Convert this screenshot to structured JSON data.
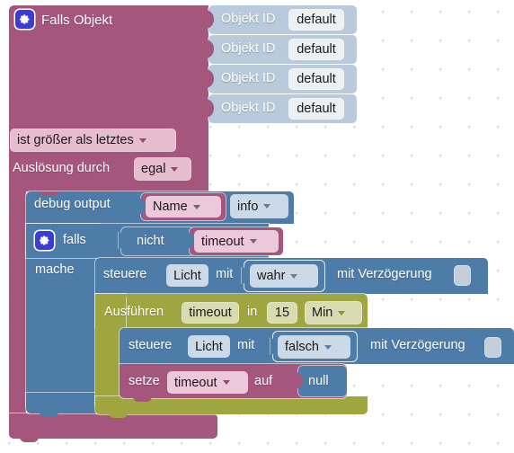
{
  "app": {
    "editor": "blockly-workspace",
    "language": "de"
  },
  "colors": {
    "trigger_magenta": "#a5567c",
    "action_blue": "#4e7ca8",
    "timeout_olive": "#a0a63f",
    "object_lightblue": "#b8cadb",
    "gear_blue": "#3b3bd6",
    "canvas": "#ffffff",
    "grid_dot": "#d8d8d8"
  },
  "blocks": {
    "trigger": {
      "gear_icon": "gear-icon",
      "title": "Falls Objekt",
      "object_rows": [
        {
          "label": "Objekt ID",
          "value": "default"
        },
        {
          "label": "Objekt ID",
          "value": "default"
        },
        {
          "label": "Objekt ID",
          "value": "default"
        },
        {
          "label": "Objekt ID",
          "value": "default"
        }
      ],
      "condition_dropdown": "ist größer als letztes",
      "source_label": "Auslösung durch",
      "source_dropdown": "egal"
    },
    "debug": {
      "label": "debug output",
      "message_dropdown": "Name",
      "severity_dropdown": "info"
    },
    "if": {
      "gear_icon": "gear-icon",
      "if_label": "falls",
      "not_label": "nicht",
      "variable_dropdown": "timeout",
      "do_label": "mache"
    },
    "control_on": {
      "verb": "steuere",
      "target": "Licht",
      "with_label": "mit",
      "value_dropdown": "wahr",
      "delay_label": "mit Verzögerung",
      "delay_checkbox": "unchecked"
    },
    "timeout": {
      "label": "Ausführen",
      "name_field": "timeout",
      "in_label": "in",
      "amount": "15",
      "unit_dropdown": "Min"
    },
    "control_off": {
      "verb": "steuere",
      "target": "Licht",
      "with_label": "mit",
      "value_dropdown": "falsch",
      "delay_label": "mit Verzögerung",
      "delay_checkbox": "unchecked"
    },
    "set_var": {
      "verb": "setze",
      "variable_dropdown": "timeout",
      "to_label": "auf",
      "value": "null"
    }
  }
}
